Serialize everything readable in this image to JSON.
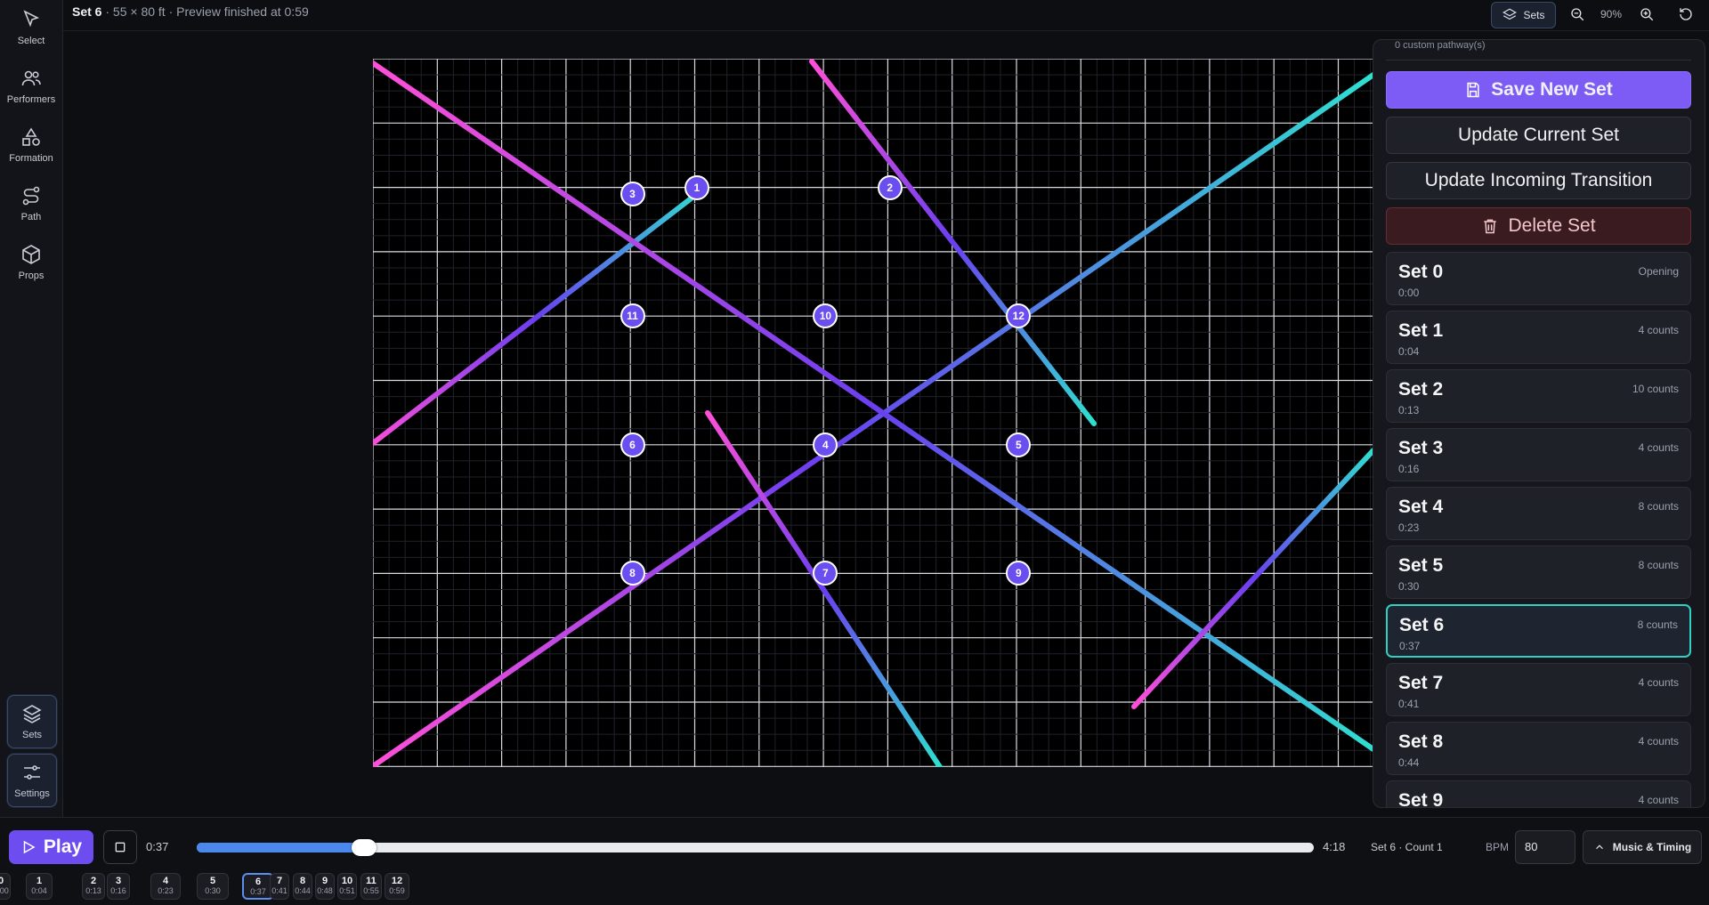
{
  "header": {
    "set_label": "Set 6",
    "meta": "· 55 × 80 ft · Preview finished at 0:59"
  },
  "toolbar": {
    "sets_label": "Sets",
    "zoom": "90%"
  },
  "sidebar": {
    "tools": [
      {
        "label": "Select",
        "icon": "cursor-icon"
      },
      {
        "label": "Performers",
        "icon": "users-icon"
      },
      {
        "label": "Formation",
        "icon": "shapes-icon"
      },
      {
        "label": "Path",
        "icon": "route-icon"
      },
      {
        "label": "Props",
        "icon": "cube-icon"
      }
    ],
    "bottom": [
      {
        "label": "Sets",
        "icon": "layers-icon"
      },
      {
        "label": "Settings",
        "icon": "sliders-icon"
      }
    ]
  },
  "field": {
    "performers": [
      {
        "label": "1",
        "x": 6.0,
        "y": 2.0
      },
      {
        "label": "2",
        "x": 9.0,
        "y": 2.0
      },
      {
        "label": "3",
        "x": 5.0,
        "y": 2.1
      },
      {
        "label": "4",
        "x": 8.0,
        "y": 6.0
      },
      {
        "label": "5",
        "x": 11.0,
        "y": 6.0
      },
      {
        "label": "6",
        "x": 5.0,
        "y": 6.0
      },
      {
        "label": "7",
        "x": 8.0,
        "y": 8.0
      },
      {
        "label": "8",
        "x": 5.0,
        "y": 8.0
      },
      {
        "label": "9",
        "x": 11.0,
        "y": 8.0
      },
      {
        "label": "10",
        "x": 8.0,
        "y": 4.0
      },
      {
        "label": "11",
        "x": 5.0,
        "y": 4.0
      },
      {
        "label": "12",
        "x": 11.0,
        "y": 4.0
      }
    ]
  },
  "colors": {
    "accent": "#7c5cf5",
    "teal": "#2fd1c4",
    "pink": "#ff4fd8",
    "danger_bg": "#3a1c20"
  },
  "panel": {
    "note": "0 custom pathway(s)",
    "save_label": "Save New Set",
    "update_label": "Update Current Set",
    "transition_label": "Update Incoming Transition",
    "delete_label": "Delete Set",
    "sets": [
      {
        "name": "Set 0",
        "time": "0:00",
        "counts": "Opening"
      },
      {
        "name": "Set 1",
        "time": "0:04",
        "counts": "4 counts"
      },
      {
        "name": "Set 2",
        "time": "0:13",
        "counts": "10 counts"
      },
      {
        "name": "Set 3",
        "time": "0:16",
        "counts": "4 counts"
      },
      {
        "name": "Set 4",
        "time": "0:23",
        "counts": "8 counts"
      },
      {
        "name": "Set 5",
        "time": "0:30",
        "counts": "8 counts"
      },
      {
        "name": "Set 6",
        "time": "0:37",
        "counts": "8 counts"
      },
      {
        "name": "Set 7",
        "time": "0:41",
        "counts": "4 counts"
      },
      {
        "name": "Set 8",
        "time": "0:44",
        "counts": "4 counts"
      },
      {
        "name": "Set 9",
        "time": "",
        "counts": "4 counts"
      }
    ]
  },
  "playback": {
    "play_label": "Play",
    "current_time": "0:37",
    "total_time": "4:18",
    "progress": 0.15,
    "status": "Set 6 · Count 1",
    "bpm_label": "BPM",
    "bpm_value": "80",
    "music_label": "Music & Timing"
  },
  "timeline": [
    {
      "n": "0",
      "t": "0:00"
    },
    {
      "n": "1",
      "t": "0:04"
    },
    {
      "n": "2",
      "t": "0:13"
    },
    {
      "n": "3",
      "t": "0:16"
    },
    {
      "n": "4",
      "t": "0:23"
    },
    {
      "n": "5",
      "t": "0:30"
    },
    {
      "n": "6",
      "t": "0:37"
    },
    {
      "n": "7",
      "t": "0:41"
    },
    {
      "n": "8",
      "t": "0:44"
    },
    {
      "n": "9",
      "t": "0:48"
    },
    {
      "n": "10",
      "t": "0:51"
    },
    {
      "n": "11",
      "t": "0:55"
    },
    {
      "n": "12",
      "t": "0:59"
    }
  ]
}
